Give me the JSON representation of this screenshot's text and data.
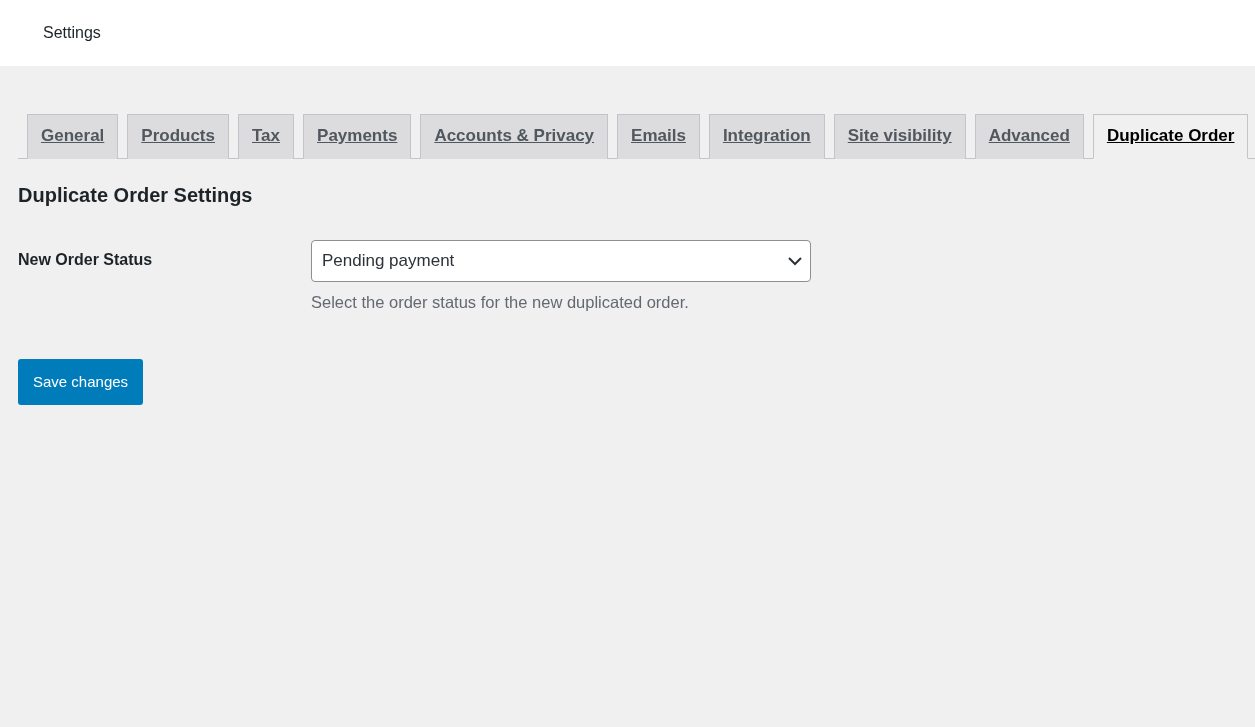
{
  "header": {
    "title": "Settings"
  },
  "tabs": [
    {
      "label": "General",
      "selected": false
    },
    {
      "label": "Products",
      "selected": false
    },
    {
      "label": "Tax",
      "selected": false
    },
    {
      "label": "Payments",
      "selected": false
    },
    {
      "label": "Accounts & Privacy",
      "selected": false
    },
    {
      "label": "Emails",
      "selected": false
    },
    {
      "label": "Integration",
      "selected": false
    },
    {
      "label": "Site visibility",
      "selected": false
    },
    {
      "label": "Advanced",
      "selected": false
    },
    {
      "label": "Duplicate Order",
      "selected": true
    }
  ],
  "section": {
    "heading": "Duplicate Order Settings",
    "fields": [
      {
        "label": "New Order Status",
        "value": "Pending payment",
        "description": "Select the order status for the new duplicated order."
      }
    ]
  },
  "buttons": [
    "Save changes"
  ]
}
